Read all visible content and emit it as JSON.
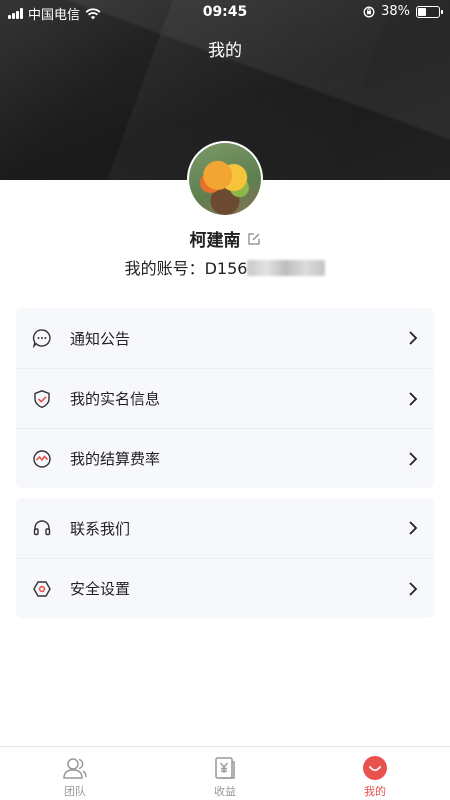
{
  "status_bar": {
    "carrier": "中国电信",
    "time": "09:45",
    "battery": "38%",
    "battery_level": 0.38
  },
  "header": {
    "title": "我的"
  },
  "profile": {
    "name": "柯建南",
    "account_label": "我的账号：",
    "account_prefix": "D156"
  },
  "menu_group_1": [
    {
      "label": "通知公告",
      "icon": "chat-bubble-icon"
    },
    {
      "label": "我的实名信息",
      "icon": "shield-check-icon"
    },
    {
      "label": "我的结算费率",
      "icon": "gauge-icon"
    }
  ],
  "menu_group_2": [
    {
      "label": "联系我们",
      "icon": "headset-icon"
    },
    {
      "label": "安全设置",
      "icon": "hexagon-settings-icon"
    }
  ],
  "tabs": [
    {
      "label": "团队",
      "icon": "team-icon",
      "active": false
    },
    {
      "label": "收益",
      "icon": "income-icon",
      "active": false
    },
    {
      "label": "我的",
      "icon": "profile-smile-icon",
      "active": true
    }
  ],
  "colors": {
    "accent": "#e8524f",
    "card_bg": "#f7f8fc",
    "header_bg": "#1e1e1e"
  }
}
